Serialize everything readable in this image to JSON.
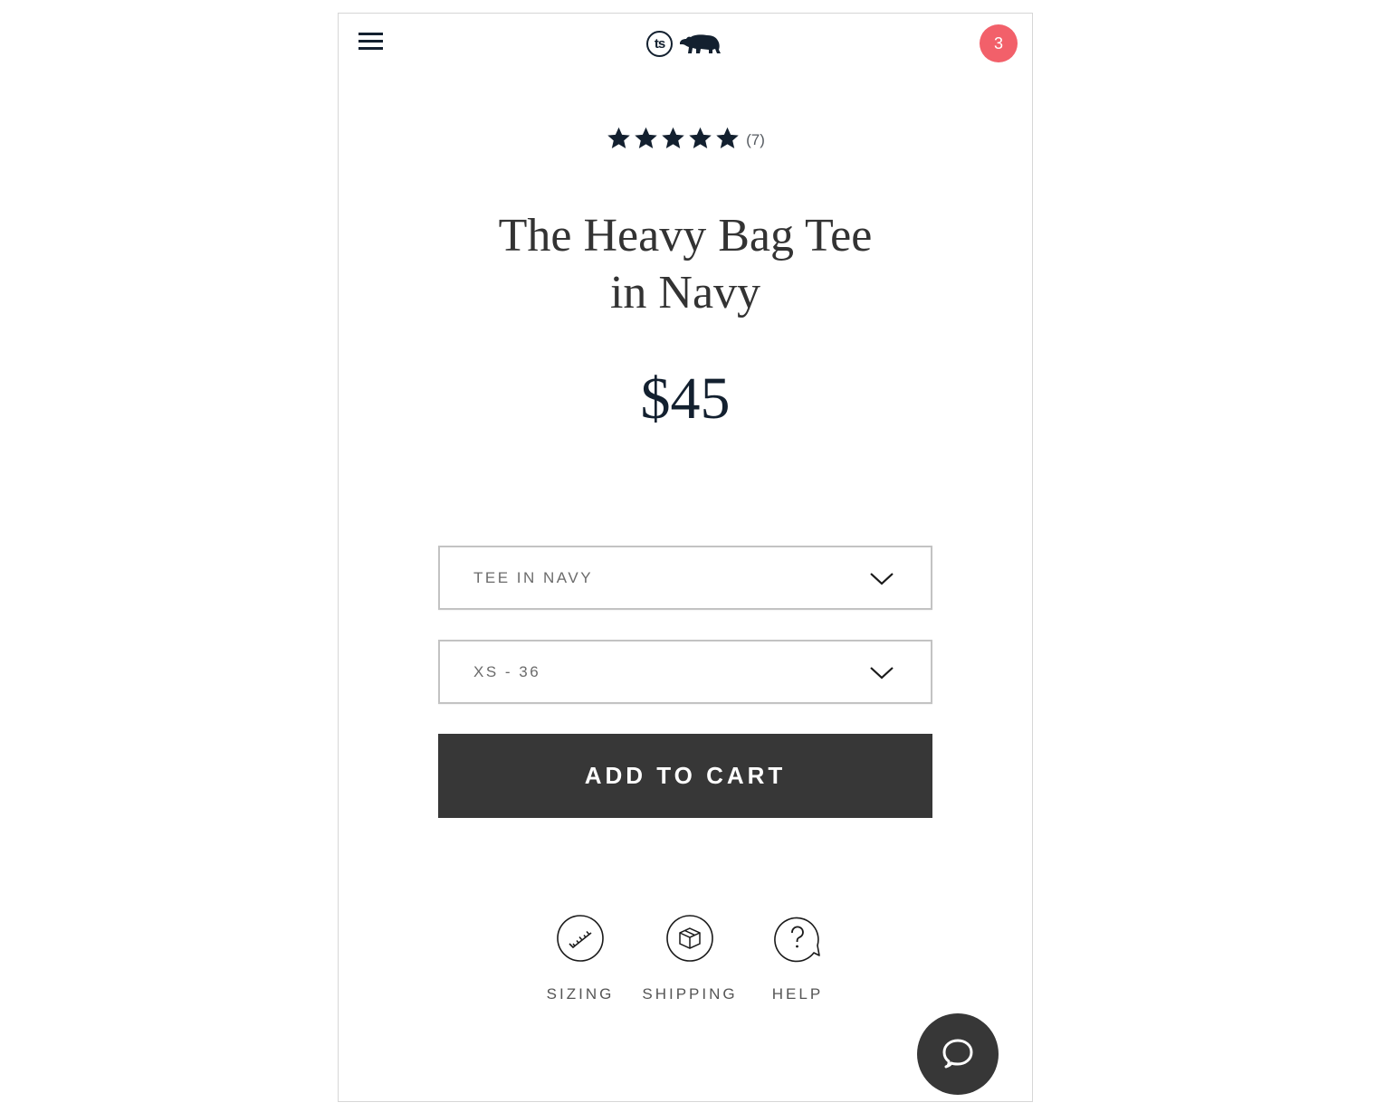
{
  "header": {
    "menu_icon": "hamburger-icon",
    "logo_text": "ts",
    "logo_icon": "bear-icon",
    "cart_count": "3",
    "cart_badge_color": "#f2606a"
  },
  "product": {
    "rating": {
      "stars": 5,
      "max_stars": 5,
      "review_count": "(7)"
    },
    "title": "The Heavy Bag Tee in Navy",
    "title_line1": "The Heavy Bag Tee",
    "title_line2": "in Navy",
    "price": "$45"
  },
  "options": {
    "color_select": {
      "value": "TEE IN NAVY",
      "icon": "chevron-down-icon"
    },
    "size_select": {
      "value": "XS - 36",
      "icon": "chevron-down-icon"
    }
  },
  "actions": {
    "add_to_cart_label": "ADD TO CART"
  },
  "info_links": [
    {
      "label": "SIZING",
      "icon": "ruler-icon"
    },
    {
      "label": "SHIPPING",
      "icon": "box-icon"
    },
    {
      "label": "HELP",
      "icon": "question-bubble-icon"
    }
  ],
  "chat": {
    "icon": "chat-bubble-icon"
  },
  "colors": {
    "navy": "#13202f",
    "button_dark": "#373737",
    "badge_red": "#f2606a"
  }
}
